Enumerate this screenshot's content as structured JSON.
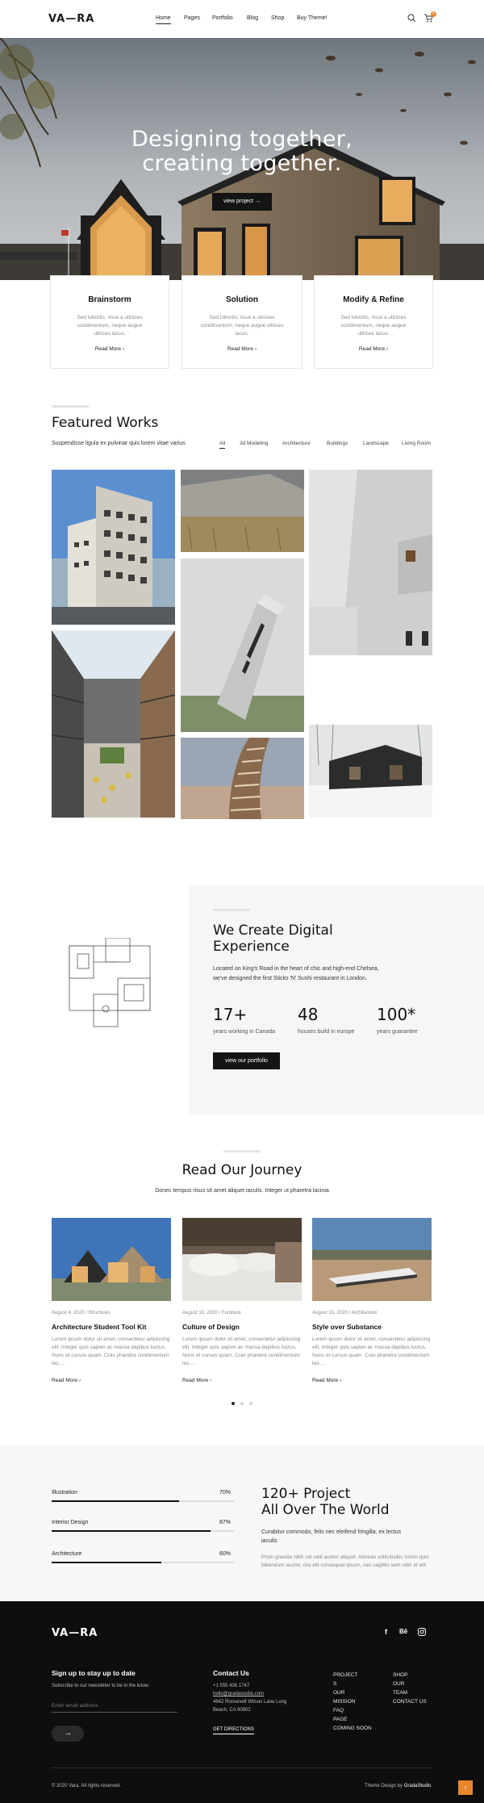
{
  "header": {
    "logo": "VA—RA",
    "nav": [
      "Home",
      "Pages",
      "Portfolio",
      "Blog",
      "Shop",
      "Buy Theme!"
    ],
    "cart_count": "0"
  },
  "hero": {
    "title_line1": "Designing together,",
    "title_line2": "creating together.",
    "button": "view project →"
  },
  "features": [
    {
      "title": "Brainstorm",
      "text": "Sed lobortis, risus a ultricies condimentum, neque augue ultrices lacus.",
      "link": "Read More"
    },
    {
      "title": "Solution",
      "text": "Sed lobortis, risus a ultricies condimentum, neque augue ultrices lacus.",
      "link": "Read More"
    },
    {
      "title": "Modify & Refine",
      "text": "Sed lobortis, risus a ultricies condimentum, neque augue ultrices lacus.",
      "link": "Read More"
    }
  ],
  "featured": {
    "title": "Featured Works",
    "subtitle": "Suspendisse ligula ex pulvinar quis lorem vitae varius",
    "filters": [
      "All",
      "3d Modeling",
      "Architecture",
      "Buildings",
      "Landscape",
      "Living Room"
    ]
  },
  "experience": {
    "title_line1": "We Create Digital",
    "title_line2": "Experience",
    "text": "Located on King's Road in the heart of chic and high-end Chelsea, we've designed the first Sticks 'N' Sushi restaurant in London.",
    "stats": [
      {
        "value": "17+",
        "label": "years working in Canada"
      },
      {
        "value": "48",
        "label": "houses build in europe"
      },
      {
        "value": "100*",
        "label": "years guarantee"
      }
    ],
    "button": "view our portfolio"
  },
  "journey": {
    "title": "Read Our Journey",
    "subtitle": "Donec tempus risus sit amet aliquet iaculis. Integer ut pharetra lacinia",
    "posts": [
      {
        "date": "August 4, 2020",
        "category": "Structures",
        "title": "Architecture Student Tool Kit",
        "text": "Lorem ipsum dolor sit amet, consectetur adipiscing elit. Integer quis sapien ac massa dapibus luctus. Nunc et cursus quam. Cras pharetra condimentum leo....",
        "link": "Read More"
      },
      {
        "date": "August 10, 2020",
        "category": "Furniture",
        "title": "Culture of Design",
        "text": "Lorem ipsum dolor sit amet, consectetur adipiscing elit. Integer quis sapien ac massa dapibus luctus. Nunc et cursus quam. Cras pharetra condimentum leo....",
        "link": "Read More"
      },
      {
        "date": "August 10, 2020",
        "category": "Architecture",
        "title": "Style over Substance",
        "text": "Lorem ipsum dolor sit amet, consectetur adipiscing elit. Integer quis sapien ac massa dapibus luctus. Nunc et cursus quam. Cras pharetra condimentum leo....",
        "link": "Read More"
      }
    ]
  },
  "skills": {
    "items": [
      {
        "label": "Illustration",
        "pct_text": "70%",
        "value": 0.7
      },
      {
        "label": "Interior Design",
        "pct_text": "87%",
        "value": 0.87
      },
      {
        "label": "Architecture",
        "pct_text": "60%",
        "value": 0.6
      }
    ],
    "title_line1": "120+ Project",
    "title_line2": "All Over The World",
    "lead": "Curabitur commodo, felis nec eleifend fringilla, ex lectus iaculis",
    "text": "Proin gravida nibh vel velit auctor aliquet. Aenean sollicitudin, lorem quis bibendum auctor, nisi elit consequat ipsum, nec sagittis sem nibh id elit."
  },
  "footer": {
    "logo": "VA—RA",
    "signup_title": "Sign up to stay up to date",
    "signup_text": "Subscribe to our newsletter to be in the know.",
    "email_placeholder": "Enter email address",
    "contact_title": "Contact Us",
    "phone": "+1 555 436 1747",
    "email": "hello@gradastudio.com",
    "address_line1": "4642 Roosevelt Wilson Lane Long",
    "address_line2": "Beach, CA 90802",
    "directions": "GET DIRECTIONS",
    "menu1": [
      "PROJECT",
      "S",
      "OUR",
      "MISSION",
      "FAQ",
      "PAGE",
      "COMING SOON"
    ],
    "menu2": [
      "SHOP",
      "OUR",
      "TEAM",
      "CONTACT US"
    ],
    "copyright": "© 2020 Vara. All rights reserved.",
    "credit_prefix": "Theme Design by",
    "credit_name": "GradaStudio"
  },
  "colors": {
    "accent": "#e8862a",
    "dark": "#141414",
    "footer_bg": "#0e0e0e"
  }
}
